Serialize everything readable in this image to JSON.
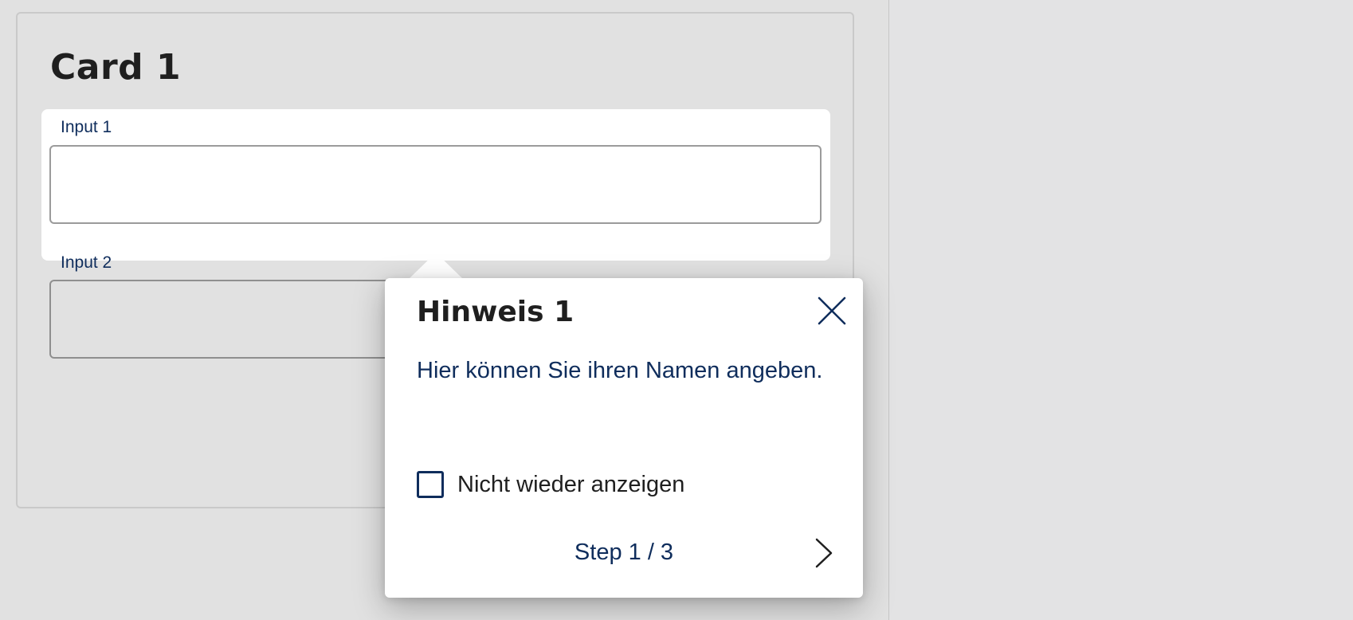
{
  "card": {
    "title": "Card 1",
    "inputs": [
      {
        "label": "Input 1",
        "value": "",
        "placeholder": ""
      },
      {
        "label": "Input 2",
        "value": "",
        "placeholder": ""
      }
    ]
  },
  "popover": {
    "title": "Hinweis 1",
    "text": "Hier können Sie ihren Namen angeben.",
    "checkbox_label": "Nicht wieder anzeigen",
    "checkbox_checked": false,
    "step_text": "Step 1 / 3",
    "close_icon": "close-icon",
    "next_icon": "chevron-right-icon"
  },
  "colors": {
    "primary_text": "#0f2d5c",
    "heading_text": "#1f1f1f",
    "page_background": "#e1e1e1",
    "surface": "#ffffff"
  }
}
